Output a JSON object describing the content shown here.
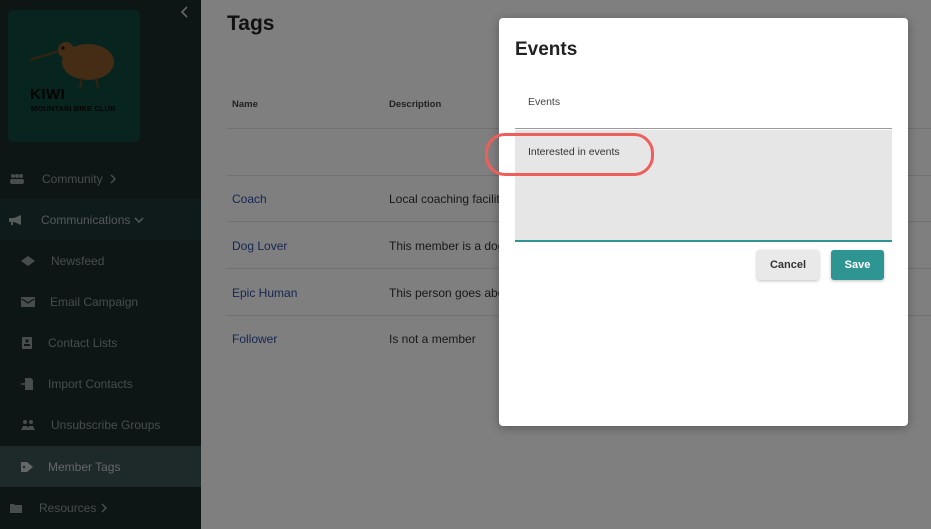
{
  "sidebar": {
    "logo": {
      "title": "KIWI",
      "subtitle": "MOUNTAIN BIKE CLUB"
    },
    "items": [
      {
        "label": "Community",
        "icon": "people-icon"
      },
      {
        "label": "Communications",
        "icon": "megaphone-icon"
      },
      {
        "label": "Newsfeed",
        "icon": "newsfeed-icon"
      },
      {
        "label": "Email Campaign",
        "icon": "email-icon"
      },
      {
        "label": "Contact Lists",
        "icon": "contact-list-icon"
      },
      {
        "label": "Import Contacts",
        "icon": "import-icon"
      },
      {
        "label": "Unsubscribe Groups",
        "icon": "group-icon"
      },
      {
        "label": "Member Tags",
        "icon": "tag-icon"
      },
      {
        "label": "Resources",
        "icon": "folder-icon"
      }
    ],
    "colors": {
      "background": "#1c2a2a",
      "active": "#3d5354"
    }
  },
  "main": {
    "title": "Tags",
    "columns": [
      "Name",
      "Description"
    ],
    "rows": [
      {
        "name": "Coach",
        "description": "Local coaching facilita"
      },
      {
        "name": "Dog Lover",
        "description": "This member is a dog"
      },
      {
        "name": "Epic Human",
        "description": "This person goes abo"
      },
      {
        "name": "Follower",
        "description": "Is not a member"
      }
    ]
  },
  "modal": {
    "title": "Events",
    "name_value": "Events",
    "description_value": "Interested in events",
    "cancel_label": "Cancel",
    "save_label": "Save",
    "colors": {
      "accent": "#2e9593",
      "highlight": "#ee5f5b"
    }
  }
}
